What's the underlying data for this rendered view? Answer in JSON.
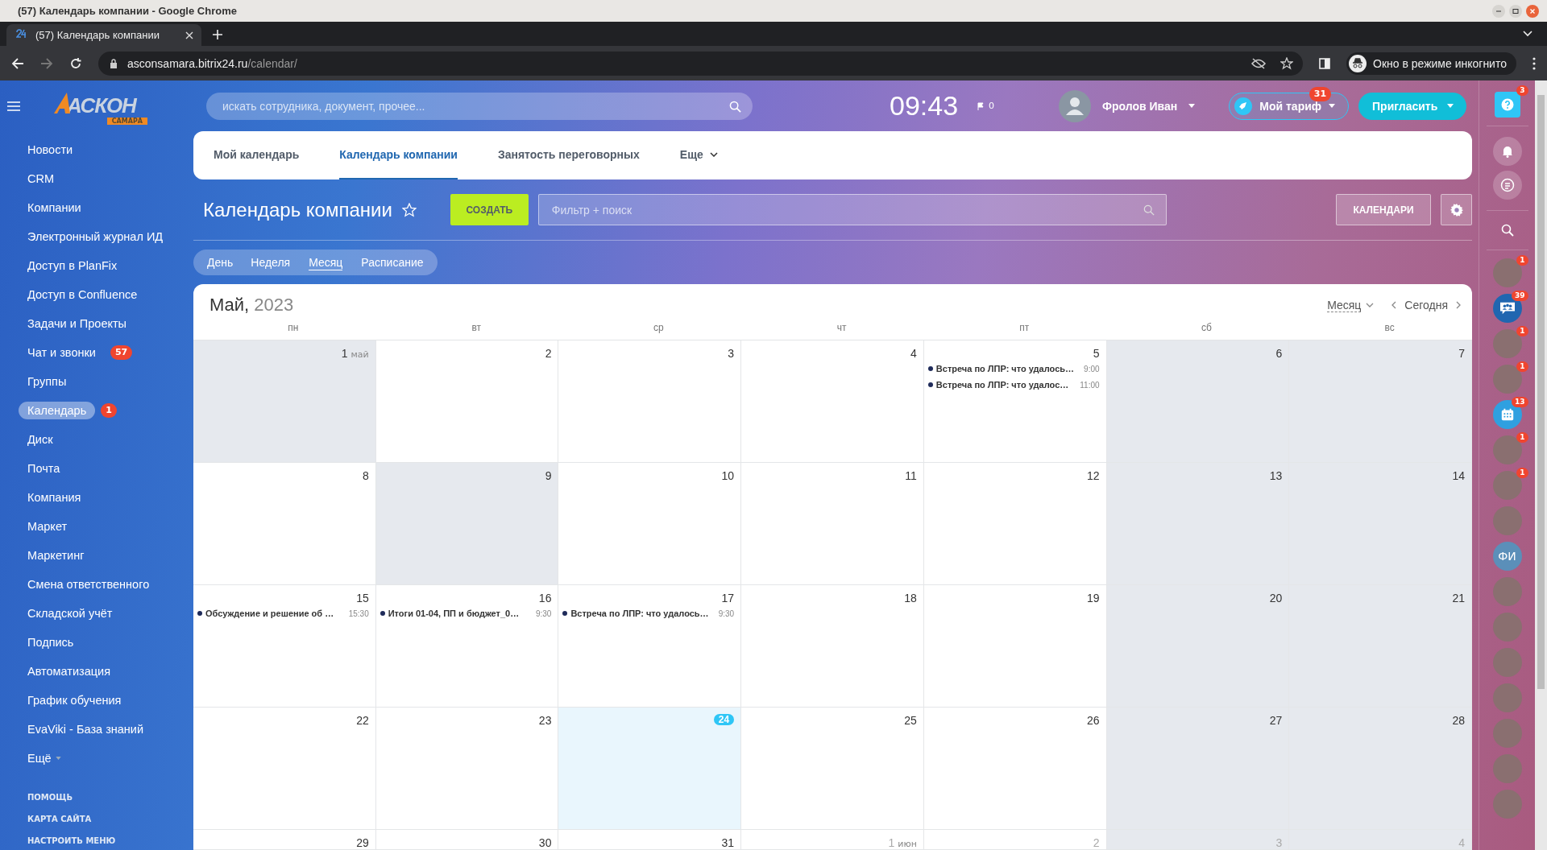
{
  "browser": {
    "window_title": "(57) Календарь компании - Google Chrome",
    "tab_title": "(57) Календарь компании",
    "url_host": "asconsamara.bitrix24.ru",
    "url_path": "/calendar/",
    "incognito_label": "Окно в режиме инкогнито"
  },
  "logo": {
    "name": "АСКОН",
    "subtitle": "САМАРА"
  },
  "header": {
    "search_placeholder": "искать сотрудника, документ, прочее...",
    "clock": "09:43",
    "flag_count": "0",
    "user_name": "Фролов Иван",
    "tariff": {
      "label": "Мой тариф",
      "badge": "31"
    },
    "invite": "Пригласить"
  },
  "sidebar": {
    "items": [
      {
        "label": "Новости",
        "selected": false
      },
      {
        "label": "CRM",
        "selected": false
      },
      {
        "label": "Компании",
        "selected": false
      },
      {
        "label": "Электронный журнал ИД",
        "selected": false
      },
      {
        "label": "Доступ в PlanFix",
        "selected": false
      },
      {
        "label": "Доступ в Confluence",
        "selected": false
      },
      {
        "label": "Задачи и Проекты",
        "selected": false
      },
      {
        "label": "Чат и звонки",
        "selected": false,
        "badge": "57"
      },
      {
        "label": "Группы",
        "selected": false
      },
      {
        "label": "Календарь",
        "selected": true,
        "badge": "1"
      },
      {
        "label": "Диск",
        "selected": false
      },
      {
        "label": "Почта",
        "selected": false
      },
      {
        "label": "Компания",
        "selected": false
      },
      {
        "label": "Маркет",
        "selected": false
      },
      {
        "label": "Маркетинг",
        "selected": false
      },
      {
        "label": "Смена ответственного",
        "selected": false
      },
      {
        "label": "Складской учёт",
        "selected": false
      },
      {
        "label": "Подпись",
        "selected": false
      },
      {
        "label": "Автоматизация",
        "selected": false
      },
      {
        "label": "График обучения",
        "selected": false
      },
      {
        "label": "EvaViki - База знаний",
        "selected": false
      },
      {
        "label": "Ещё",
        "selected": false,
        "kind": "more"
      }
    ],
    "footer_links": [
      "ПОМОЩЬ",
      "КАРТА САЙТА",
      "НАСТРОИТЬ МЕНЮ"
    ]
  },
  "top_tabs": [
    {
      "label": "Мой календарь",
      "selected": false
    },
    {
      "label": "Календарь компании",
      "selected": true
    },
    {
      "label": "Занятость переговорных",
      "selected": false
    },
    {
      "label": "Еще",
      "selected": false,
      "kind": "more"
    }
  ],
  "toolbar": {
    "title": "Календарь компании",
    "create": "СОЗДАТЬ",
    "filter_placeholder": "Фильтр + поиск",
    "calendars": "КАЛЕНДАРИ"
  },
  "view_tabs": [
    {
      "label": "День",
      "selected": false
    },
    {
      "label": "Неделя",
      "selected": false
    },
    {
      "label": "Месяц",
      "selected": true
    },
    {
      "label": "Расписание",
      "selected": false
    }
  ],
  "calendar": {
    "month": "Май,",
    "year": "2023",
    "view_select": "Месяц",
    "today": "Сегодня",
    "weekdays": [
      "пн",
      "вт",
      "ср",
      "чт",
      "пт",
      "сб",
      "вс"
    ],
    "weeks": [
      [
        {
          "day": "1",
          "month_label": "май",
          "shaded": true,
          "today": false,
          "other_month": false
        },
        {
          "day": "2",
          "shaded": false,
          "today": false,
          "other_month": false
        },
        {
          "day": "3",
          "shaded": false,
          "today": false,
          "other_month": false
        },
        {
          "day": "4",
          "shaded": false,
          "today": false,
          "other_month": false
        },
        {
          "day": "5",
          "shaded": false,
          "today": false,
          "other_month": false,
          "events": [
            {
              "title": "Встреча по ЛПР: что удалось…",
              "time": "9:00"
            },
            {
              "title": "Встреча по ЛПР: что удалос…",
              "time": "11:00"
            }
          ]
        },
        {
          "day": "6",
          "shaded": true,
          "today": false,
          "other_month": false
        },
        {
          "day": "7",
          "shaded": true,
          "today": false,
          "other_month": false
        }
      ],
      [
        {
          "day": "8",
          "shaded": false,
          "today": false,
          "other_month": false
        },
        {
          "day": "9",
          "shaded": true,
          "today": false,
          "other_month": false
        },
        {
          "day": "10",
          "shaded": false,
          "today": false,
          "other_month": false
        },
        {
          "day": "11",
          "shaded": false,
          "today": false,
          "other_month": false
        },
        {
          "day": "12",
          "shaded": false,
          "today": false,
          "other_month": false
        },
        {
          "day": "13",
          "shaded": true,
          "today": false,
          "other_month": false
        },
        {
          "day": "14",
          "shaded": true,
          "today": false,
          "other_month": false
        }
      ],
      [
        {
          "day": "15",
          "shaded": false,
          "today": false,
          "other_month": false,
          "events": [
            {
              "title": "Обсуждение и решение об …",
              "time": "15:30"
            }
          ]
        },
        {
          "day": "16",
          "shaded": false,
          "today": false,
          "other_month": false,
          "events": [
            {
              "title": "Итоги 01-04, ПП и бюджет_0…",
              "time": "9:30"
            }
          ]
        },
        {
          "day": "17",
          "shaded": false,
          "today": false,
          "other_month": false,
          "events": [
            {
              "title": "Встреча по ЛПР: что удалось…",
              "time": "9:30"
            }
          ]
        },
        {
          "day": "18",
          "shaded": false,
          "today": false,
          "other_month": false
        },
        {
          "day": "19",
          "shaded": false,
          "today": false,
          "other_month": false
        },
        {
          "day": "20",
          "shaded": true,
          "today": false,
          "other_month": false
        },
        {
          "day": "21",
          "shaded": true,
          "today": false,
          "other_month": false
        }
      ],
      [
        {
          "day": "22",
          "shaded": false,
          "today": false,
          "other_month": false
        },
        {
          "day": "23",
          "shaded": false,
          "today": false,
          "other_month": false
        },
        {
          "day": "24",
          "shaded": false,
          "today": true,
          "other_month": false
        },
        {
          "day": "25",
          "shaded": false,
          "today": false,
          "other_month": false
        },
        {
          "day": "26",
          "shaded": false,
          "today": false,
          "other_month": false
        },
        {
          "day": "27",
          "shaded": true,
          "today": false,
          "other_month": false
        },
        {
          "day": "28",
          "shaded": true,
          "today": false,
          "other_month": false
        }
      ],
      [
        {
          "day": "29",
          "shaded": false,
          "today": false,
          "other_month": false
        },
        {
          "day": "30",
          "shaded": false,
          "today": false,
          "other_month": false
        },
        {
          "day": "31",
          "shaded": false,
          "today": false,
          "other_month": false
        },
        {
          "day": "1",
          "month_label": "июн",
          "shaded": false,
          "today": false,
          "other_month": true
        },
        {
          "day": "2",
          "shaded": false,
          "today": false,
          "other_month": true
        },
        {
          "day": "3",
          "shaded": true,
          "today": false,
          "other_month": true
        },
        {
          "day": "4",
          "shaded": true,
          "today": false,
          "other_month": true
        }
      ]
    ]
  },
  "right_bar": {
    "help_badge": "3",
    "contacts": [
      {
        "kind": "photo",
        "badge": "1"
      },
      {
        "kind": "group-chat",
        "badge": "39"
      },
      {
        "kind": "photo",
        "badge": "1"
      },
      {
        "kind": "photo",
        "badge": "1"
      },
      {
        "kind": "calendar",
        "badge": "13"
      },
      {
        "kind": "photo",
        "badge": "1"
      },
      {
        "kind": "photo",
        "badge": "1"
      },
      {
        "kind": "photo"
      },
      {
        "kind": "initials",
        "initials": "ФИ"
      },
      {
        "kind": "photo"
      },
      {
        "kind": "photo"
      },
      {
        "kind": "photo"
      },
      {
        "kind": "photo"
      },
      {
        "kind": "photo"
      },
      {
        "kind": "photo"
      },
      {
        "kind": "photo"
      }
    ]
  }
}
